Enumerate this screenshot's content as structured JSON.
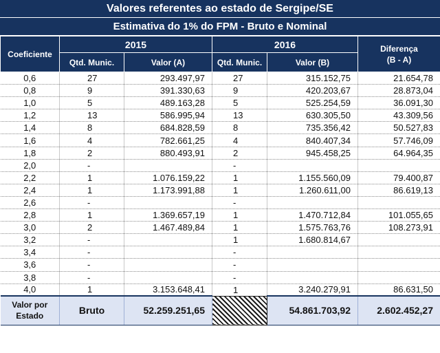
{
  "title": "Valores referentes ao estado de Sergipe/SE",
  "subtitle": "Estimativa do 1% do FPM - Bruto e Nominal",
  "headers": {
    "coeficiente": "Coeficiente",
    "year_a": "2015",
    "year_b": "2016",
    "diferenca": "Diferença",
    "diferenca_formula": "(B - A)",
    "qtd_a": "Qtd. Munic.",
    "valor_a": "Valor (A)",
    "qtd_b": "Qtd. Munic.",
    "valor_b": "Valor (B)"
  },
  "rows": [
    {
      "coef": "0,6",
      "qa": "27",
      "va": "293.497,97",
      "qb": "27",
      "vb": "315.152,75",
      "diff": "21.654,78"
    },
    {
      "coef": "0,8",
      "qa": "9",
      "va": "391.330,63",
      "qb": "9",
      "vb": "420.203,67",
      "diff": "28.873,04"
    },
    {
      "coef": "1,0",
      "qa": "5",
      "va": "489.163,28",
      "qb": "5",
      "vb": "525.254,59",
      "diff": "36.091,30"
    },
    {
      "coef": "1,2",
      "qa": "13",
      "va": "586.995,94",
      "qb": "13",
      "vb": "630.305,50",
      "diff": "43.309,56"
    },
    {
      "coef": "1,4",
      "qa": "8",
      "va": "684.828,59",
      "qb": "8",
      "vb": "735.356,42",
      "diff": "50.527,83"
    },
    {
      "coef": "1,6",
      "qa": "4",
      "va": "782.661,25",
      "qb": "4",
      "vb": "840.407,34",
      "diff": "57.746,09"
    },
    {
      "coef": "1,8",
      "qa": "2",
      "va": "880.493,91",
      "qb": "2",
      "vb": "945.458,25",
      "diff": "64.964,35"
    },
    {
      "coef": "2,0",
      "qa": "-",
      "va": "",
      "qb": "-",
      "vb": "",
      "diff": ""
    },
    {
      "coef": "2,2",
      "qa": "1",
      "va": "1.076.159,22",
      "qb": "1",
      "vb": "1.155.560,09",
      "diff": "79.400,87"
    },
    {
      "coef": "2,4",
      "qa": "1",
      "va": "1.173.991,88",
      "qb": "1",
      "vb": "1.260.611,00",
      "diff": "86.619,13"
    },
    {
      "coef": "2,6",
      "qa": "-",
      "va": "",
      "qb": "-",
      "vb": "",
      "diff": ""
    },
    {
      "coef": "2,8",
      "qa": "1",
      "va": "1.369.657,19",
      "qb": "1",
      "vb": "1.470.712,84",
      "diff": "101.055,65"
    },
    {
      "coef": "3,0",
      "qa": "2",
      "va": "1.467.489,84",
      "qb": "1",
      "vb": "1.575.763,76",
      "diff": "108.273,91"
    },
    {
      "coef": "3,2",
      "qa": "-",
      "va": "",
      "qb": "1",
      "vb": "1.680.814,67",
      "diff": ""
    },
    {
      "coef": "3,4",
      "qa": "-",
      "va": "",
      "qb": "-",
      "vb": "",
      "diff": ""
    },
    {
      "coef": "3,6",
      "qa": "-",
      "va": "",
      "qb": "-",
      "vb": "",
      "diff": ""
    },
    {
      "coef": "3,8",
      "qa": "-",
      "va": "",
      "qb": "-",
      "vb": "",
      "diff": ""
    },
    {
      "coef": "4,0",
      "qa": "1",
      "va": "3.153.648,41",
      "qb": "1",
      "vb": "3.240.279,91",
      "diff": "86.631,50"
    }
  ],
  "total": {
    "label_line1": "Valor por",
    "label_line2": "Estado",
    "type": "Bruto",
    "valor_a": "52.259.251,65",
    "valor_b": "54.861.703,92",
    "diff": "2.602.452,27"
  }
}
